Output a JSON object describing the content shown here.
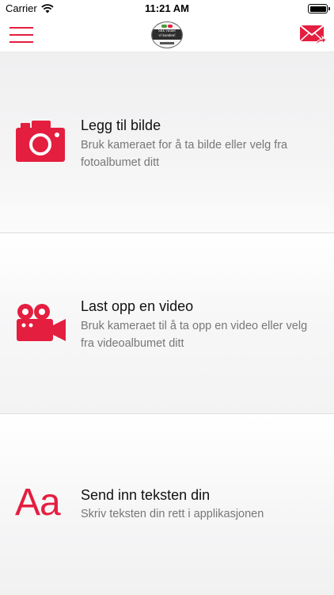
{
  "status_bar": {
    "carrier": "Carrier",
    "time": "11:21 AM"
  },
  "nav_bar": {
    "logo_text": "Slik vinner vi kunden!"
  },
  "rows": [
    {
      "title": "Legg til bilde",
      "description": "Bruk kameraet for å ta bilde eller velg fra fotoalbumet ditt",
      "icon": "camera-icon"
    },
    {
      "title": "Last opp en video",
      "description": "Bruk kameraet til å ta opp en video eller velg fra videoalbumet ditt",
      "icon": "video-camera-icon"
    },
    {
      "title": "Send inn teksten din",
      "description": "Skriv teksten din rett i applikasjonen",
      "icon": "text-icon",
      "icon_glyph": "Aa"
    }
  ],
  "colors": {
    "accent": "#e41e3f",
    "title_text": "#111111",
    "description_text": "#777777"
  }
}
